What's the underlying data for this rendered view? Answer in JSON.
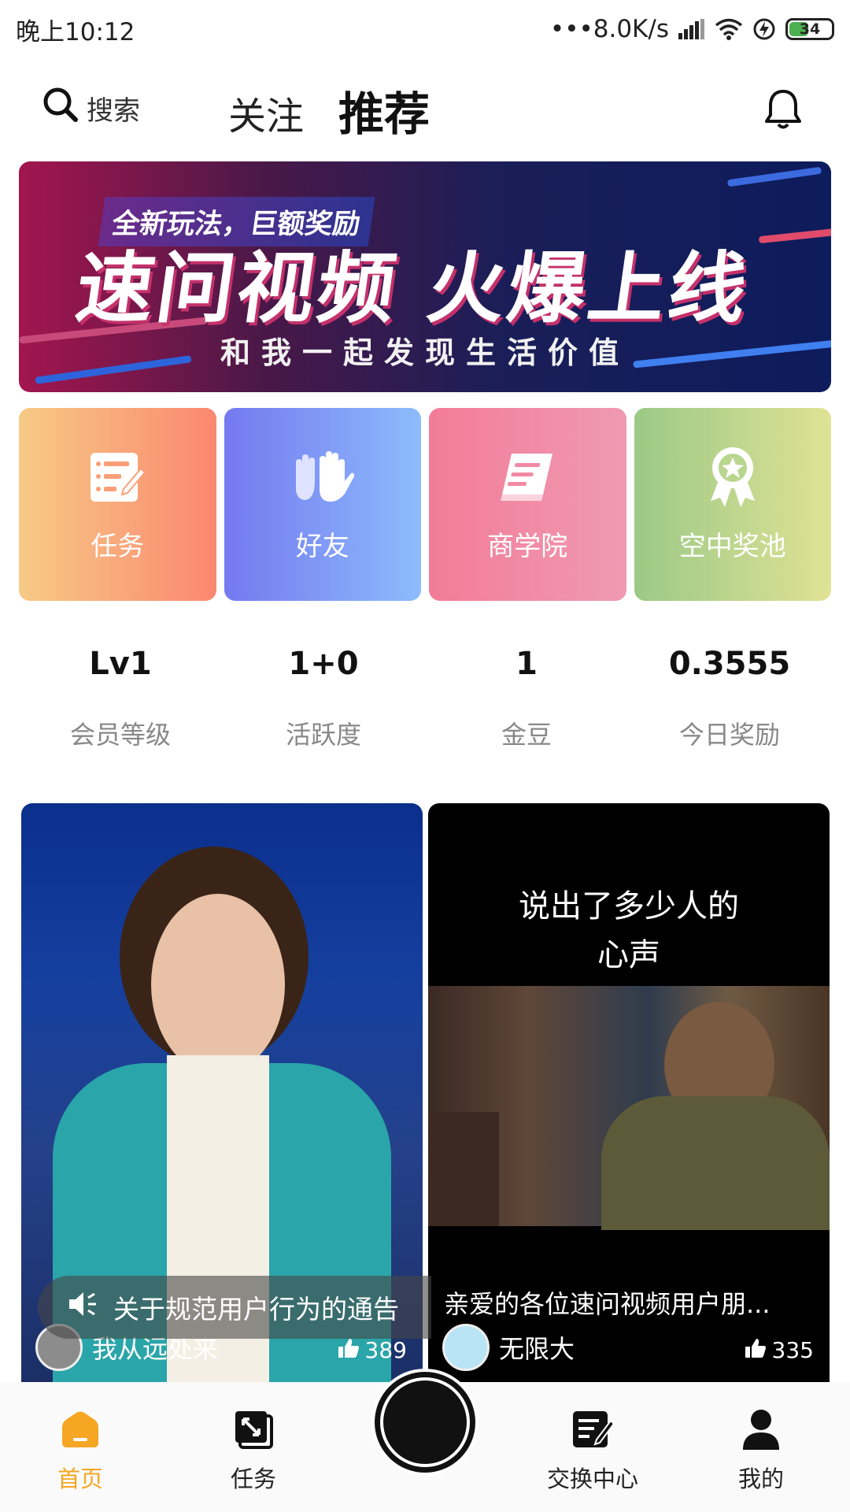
{
  "status_bar": {
    "time": "晚上10:12",
    "network_speed": "•••8.0K/s",
    "battery": "34"
  },
  "header": {
    "search_label": "搜索",
    "tab_follow": "关注",
    "tab_recommend": "推荐"
  },
  "banner": {
    "tag": "全新玩法，巨额奖励",
    "headline": "速问视频 火爆上线",
    "subline": "和我一起发现生活价值"
  },
  "tiles": [
    {
      "label": "任务",
      "icon": "task-list-icon"
    },
    {
      "label": "好友",
      "icon": "hands-icon"
    },
    {
      "label": "商学院",
      "icon": "book-icon"
    },
    {
      "label": "空中奖池",
      "icon": "award-badge-icon"
    }
  ],
  "stats": [
    {
      "value": "Lv1",
      "label": "会员等级"
    },
    {
      "value": "1+0",
      "label": "活跃度"
    },
    {
      "value": "1",
      "label": "金豆"
    },
    {
      "value": "0.3555",
      "label": "今日奖励"
    }
  ],
  "notice": {
    "text": "关于规范用户行为的通告"
  },
  "feed": [
    {
      "author": "我从远处来",
      "likes": "389",
      "caption": ""
    },
    {
      "author": "无限大",
      "likes": "335",
      "caption": "亲爱的各位速问视频用户朋...",
      "overlay_text": "说出了多少人的\n心声"
    }
  ],
  "bottom_nav": [
    {
      "label": "首页",
      "active": true
    },
    {
      "label": "任务"
    },
    {
      "label": "交换中心"
    },
    {
      "label": "我的"
    }
  ],
  "colors": {
    "accent": "#f5a623"
  }
}
